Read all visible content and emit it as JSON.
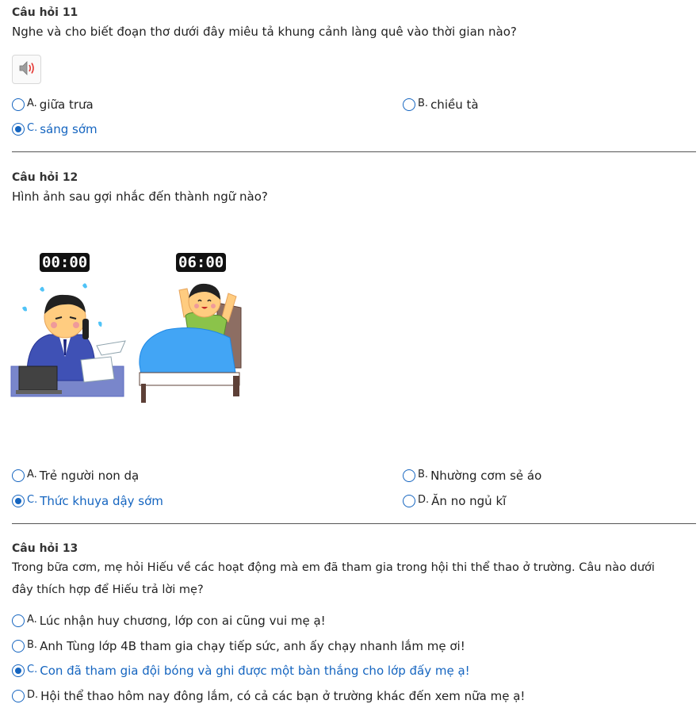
{
  "q11": {
    "title": "Câu hỏi 11",
    "text": "Nghe và cho biết đoạn thơ dưới đây miêu tả khung cảnh làng quê vào thời gian nào?",
    "audio_icon": "speaker-icon",
    "options": [
      {
        "letter": "A.",
        "text": "giữa trưa",
        "selected": false
      },
      {
        "letter": "B.",
        "text": "chiều tà",
        "selected": false
      },
      {
        "letter": "C.",
        "text": "sáng sớm",
        "selected": true
      }
    ]
  },
  "q12": {
    "title": "Câu hỏi 12",
    "text": "Hình ảnh sau gợi nhắc đến thành ngữ nào?",
    "clock_left": "00:00",
    "clock_right": "06:00",
    "options": [
      {
        "letter": "A.",
        "text": "Trẻ người non dạ",
        "selected": false
      },
      {
        "letter": "B.",
        "text": "Nhường cơm sẻ áo",
        "selected": false
      },
      {
        "letter": "C.",
        "text": "Thức khuya dậy sớm",
        "selected": true
      },
      {
        "letter": "D.",
        "text": "Ăn no ngủ kĩ",
        "selected": false
      }
    ]
  },
  "q13": {
    "title": "Câu hỏi 13",
    "text_line1": "Trong bữa cơm, mẹ hỏi Hiếu về các hoạt động mà em đã tham gia trong hội thi thể thao ở trường. Câu nào dưới",
    "text_line2": "đây thích hợp để Hiếu trả lời mẹ?",
    "options": [
      {
        "letter": "A.",
        "text": "Lúc nhận huy chương, lớp con ai cũng vui mẹ ạ!",
        "selected": false
      },
      {
        "letter": "B.",
        "text": "Anh Tùng lớp 4B tham gia chạy tiếp sức, anh ấy chạy nhanh lắm mẹ ơi!",
        "selected": false
      },
      {
        "letter": "C.",
        "text": "Con đã tham gia đội bóng và ghi được một bàn thắng cho lớp đấy mẹ ạ!",
        "selected": true
      },
      {
        "letter": "D.",
        "text": "Hội thể thao hôm nay đông lắm, có cả các bạn ở trường khác đến xem nữa mẹ ạ!",
        "selected": false
      }
    ]
  },
  "colors": {
    "accent": "#1565c0",
    "text": "#222222",
    "divider": "#555555"
  }
}
